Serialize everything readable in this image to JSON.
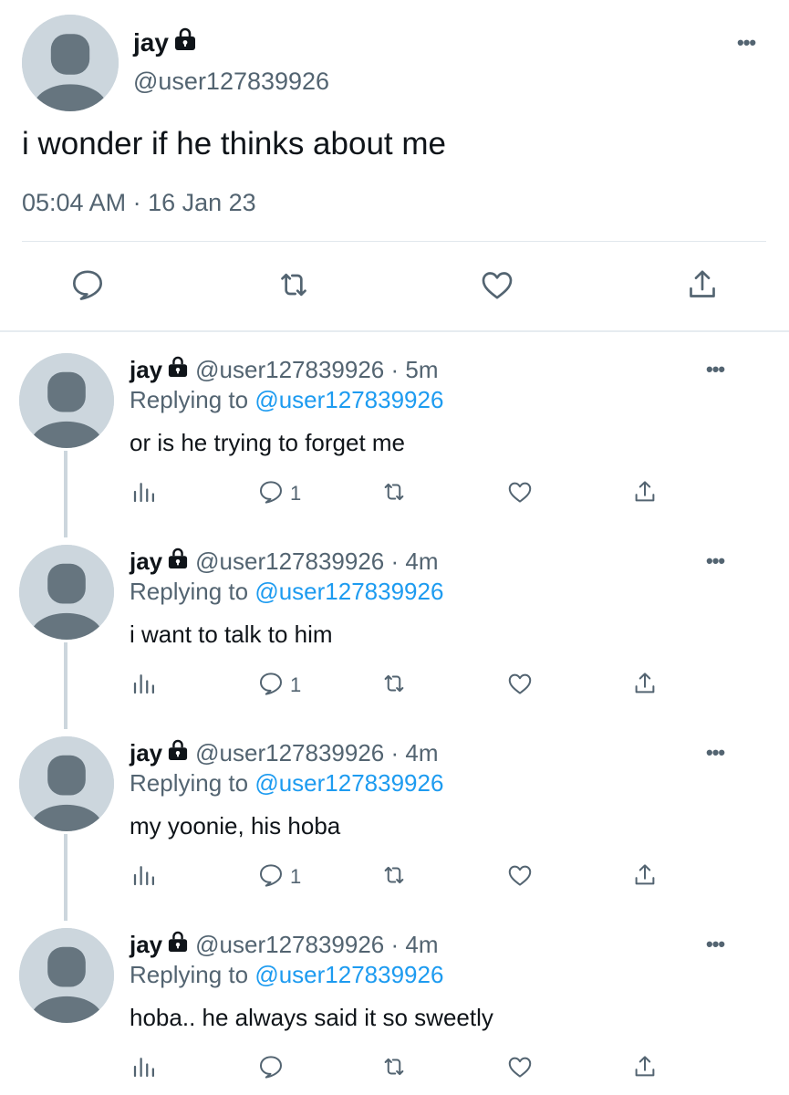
{
  "main_tweet": {
    "name": "jay",
    "handle": "@user127839926",
    "text": "i wonder if he thinks about me",
    "timestamp": "05:04 AM · 16 Jan 23",
    "icons": [
      "reply-icon",
      "retweet-icon",
      "like-icon",
      "share-icon"
    ]
  },
  "replies": [
    {
      "name": "jay",
      "handle_time": "@user127839926 · 5m",
      "replying_label": "Replying to",
      "mention": "@user127839926",
      "text": "or is he trying to forget me",
      "reply_count": "1"
    },
    {
      "name": "jay",
      "handle_time": "@user127839926 · 4m",
      "replying_label": "Replying to",
      "mention": "@user127839926",
      "text": "i want to talk to him",
      "reply_count": "1"
    },
    {
      "name": "jay",
      "handle_time": "@user127839926 · 4m",
      "replying_label": "Replying to",
      "mention": "@user127839926",
      "text": "my yoonie, his hoba",
      "reply_count": "1"
    },
    {
      "name": "jay",
      "handle_time": "@user127839926 · 4m",
      "replying_label": "Replying to",
      "mention": "@user127839926",
      "text": "hoba.. he always said it so sweetly",
      "reply_count": ""
    }
  ],
  "colors": {
    "text": "#0f1419",
    "secondary": "#536471",
    "link": "#1d9bf0",
    "avatar_bg": "#ccd6dd",
    "avatar_fg": "#66757f"
  }
}
